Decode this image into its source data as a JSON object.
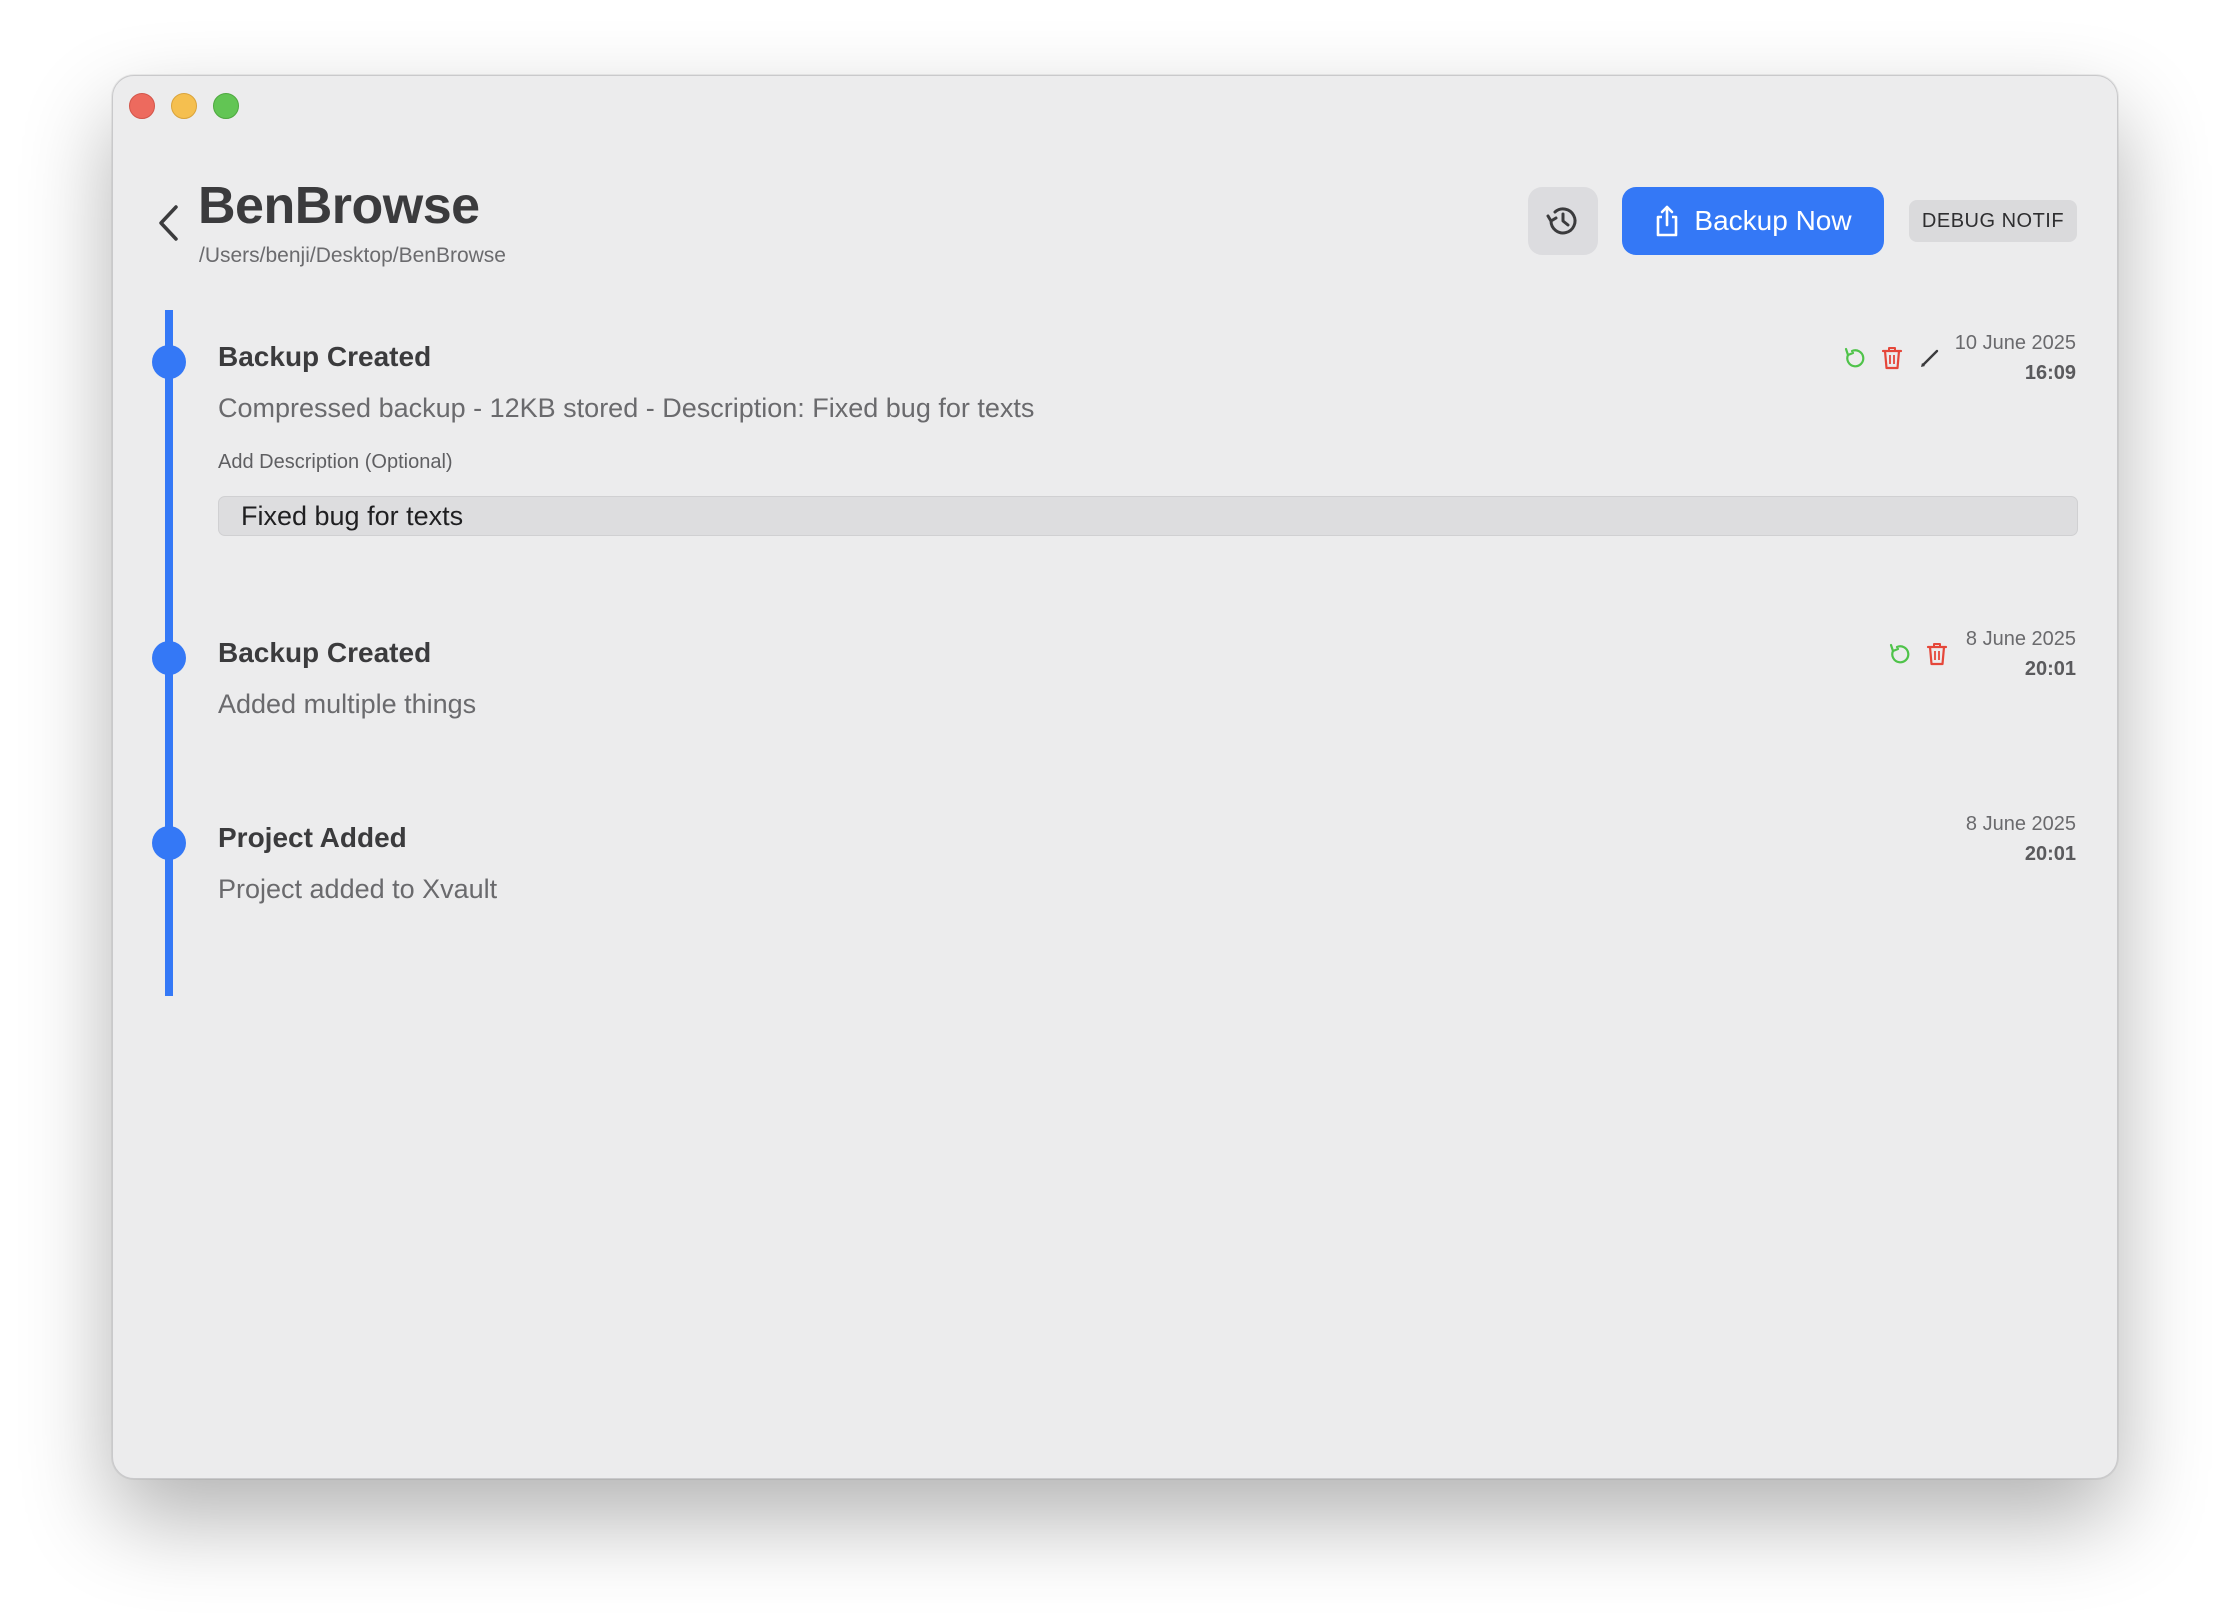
{
  "window": {
    "controls": [
      "close",
      "minimize",
      "maximize"
    ]
  },
  "header": {
    "title": "BenBrowse",
    "path": "/Users/benji/Desktop/BenBrowse",
    "backup_label": "Backup Now",
    "debug_label": "DEBUG NOTIF",
    "icons": {
      "back": "chevron-left-icon",
      "history": "clock-history-icon",
      "backup": "share-upload-icon"
    }
  },
  "timeline": {
    "entries": [
      {
        "title": "Backup Created",
        "description": "Compressed backup - 12KB stored - Description: Fixed bug for texts",
        "date": "10 June 2025",
        "time": "16:09",
        "actions": [
          "restore-icon",
          "trash-icon",
          "pencil-icon"
        ]
      },
      {
        "title": "Backup Created",
        "description": "Added multiple things",
        "date": "8 June 2025",
        "time": "20:01",
        "actions": [
          "restore-icon",
          "trash-icon"
        ]
      },
      {
        "title": "Project Added",
        "description": "Project added to Xvault",
        "date": "8 June 2025",
        "time": "20:01",
        "actions": []
      }
    ],
    "edit": {
      "label": "Add Description (Optional)",
      "value": "Fixed bug for texts"
    }
  },
  "colors": {
    "accent": "#3478f6",
    "restore": "#4fc34a",
    "delete": "#e5473a",
    "window_bg": "#ececed"
  }
}
